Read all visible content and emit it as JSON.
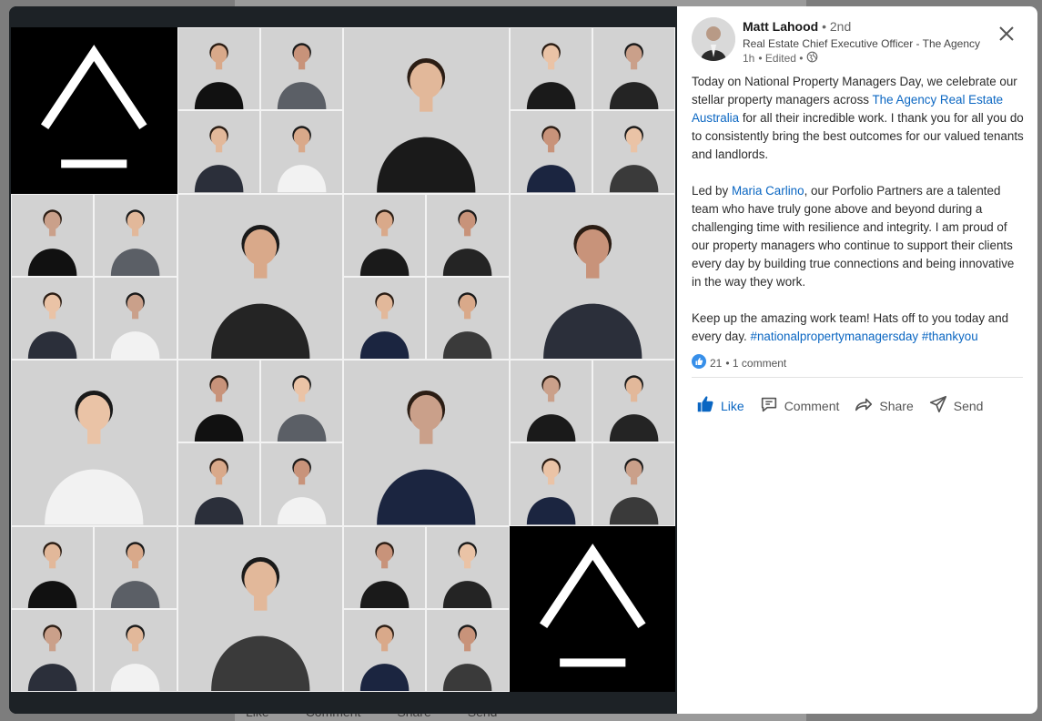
{
  "author": {
    "name": "Matt Lahood",
    "degree": "• 2nd",
    "title": "Real Estate Chief Executive Officer - The Agency",
    "time": "1h",
    "edited": "• Edited •"
  },
  "post": {
    "p1_a": "Today on National Property Managers Day, we celebrate our stellar property managers across ",
    "p1_link": "The Agency Real Estate Australia",
    "p1_b": " for all their incredible work. I thank you for all you do to consistently bring the best outcomes for our valued tenants and landlords.",
    "p2_a": "Led by ",
    "p2_link": "Maria Carlino",
    "p2_b": ", our Porfolio Partners are a talented team who have truly gone above and beyond during a challenging time with resilience and integrity. I am proud of our property managers who continue to support their clients every day by building true connections and being innovative in the way they work.",
    "p3_a": "Keep up the amazing work team! Hats off to you today and every day. ",
    "tag1": "#nationalpropertymanagersday",
    "tag2": "#thankyou"
  },
  "social": {
    "reactions": "21",
    "comments": "• 1 comment"
  },
  "actions": {
    "like": "Like",
    "comment": "Comment",
    "share": "Share",
    "send": "Send"
  },
  "feed_actions": {
    "like": "Like",
    "comment": "Comment",
    "share": "Share",
    "send": "Send"
  },
  "colors": {
    "link": "#0a66c2",
    "modal_bg": "#1d2226",
    "logo_bg": "#000000"
  }
}
